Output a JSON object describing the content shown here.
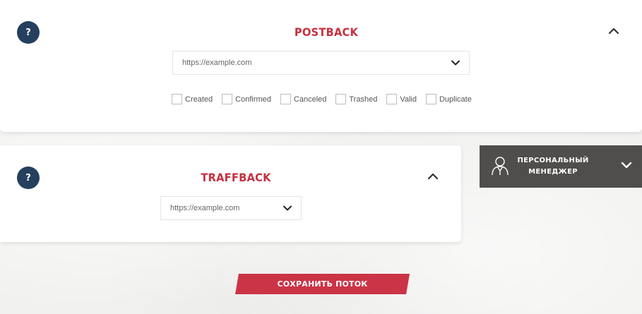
{
  "postback": {
    "help_icon": "?",
    "title": "POSTBACK",
    "url_value": "https://example.com",
    "statuses": [
      {
        "label": "Created"
      },
      {
        "label": "Confirmed"
      },
      {
        "label": "Canceled"
      },
      {
        "label": "Trashed"
      },
      {
        "label": "Valid"
      },
      {
        "label": "Duplicate"
      }
    ]
  },
  "traffback": {
    "help_icon": "?",
    "title": "TRAFFBACK",
    "url_value": "https://example.com"
  },
  "manager": {
    "line1": "ПЕРСОНАЛЬНЫЙ",
    "line2": "МЕНЕДЖЕР",
    "icon": "person-icon"
  },
  "save_button": {
    "label": "СОХРАНИТЬ ПОТОК"
  },
  "colors": {
    "accent": "#c63142",
    "help_badge": "#24405e",
    "manager_panel": "#4f4e4c",
    "save_button": "#cb3446"
  }
}
